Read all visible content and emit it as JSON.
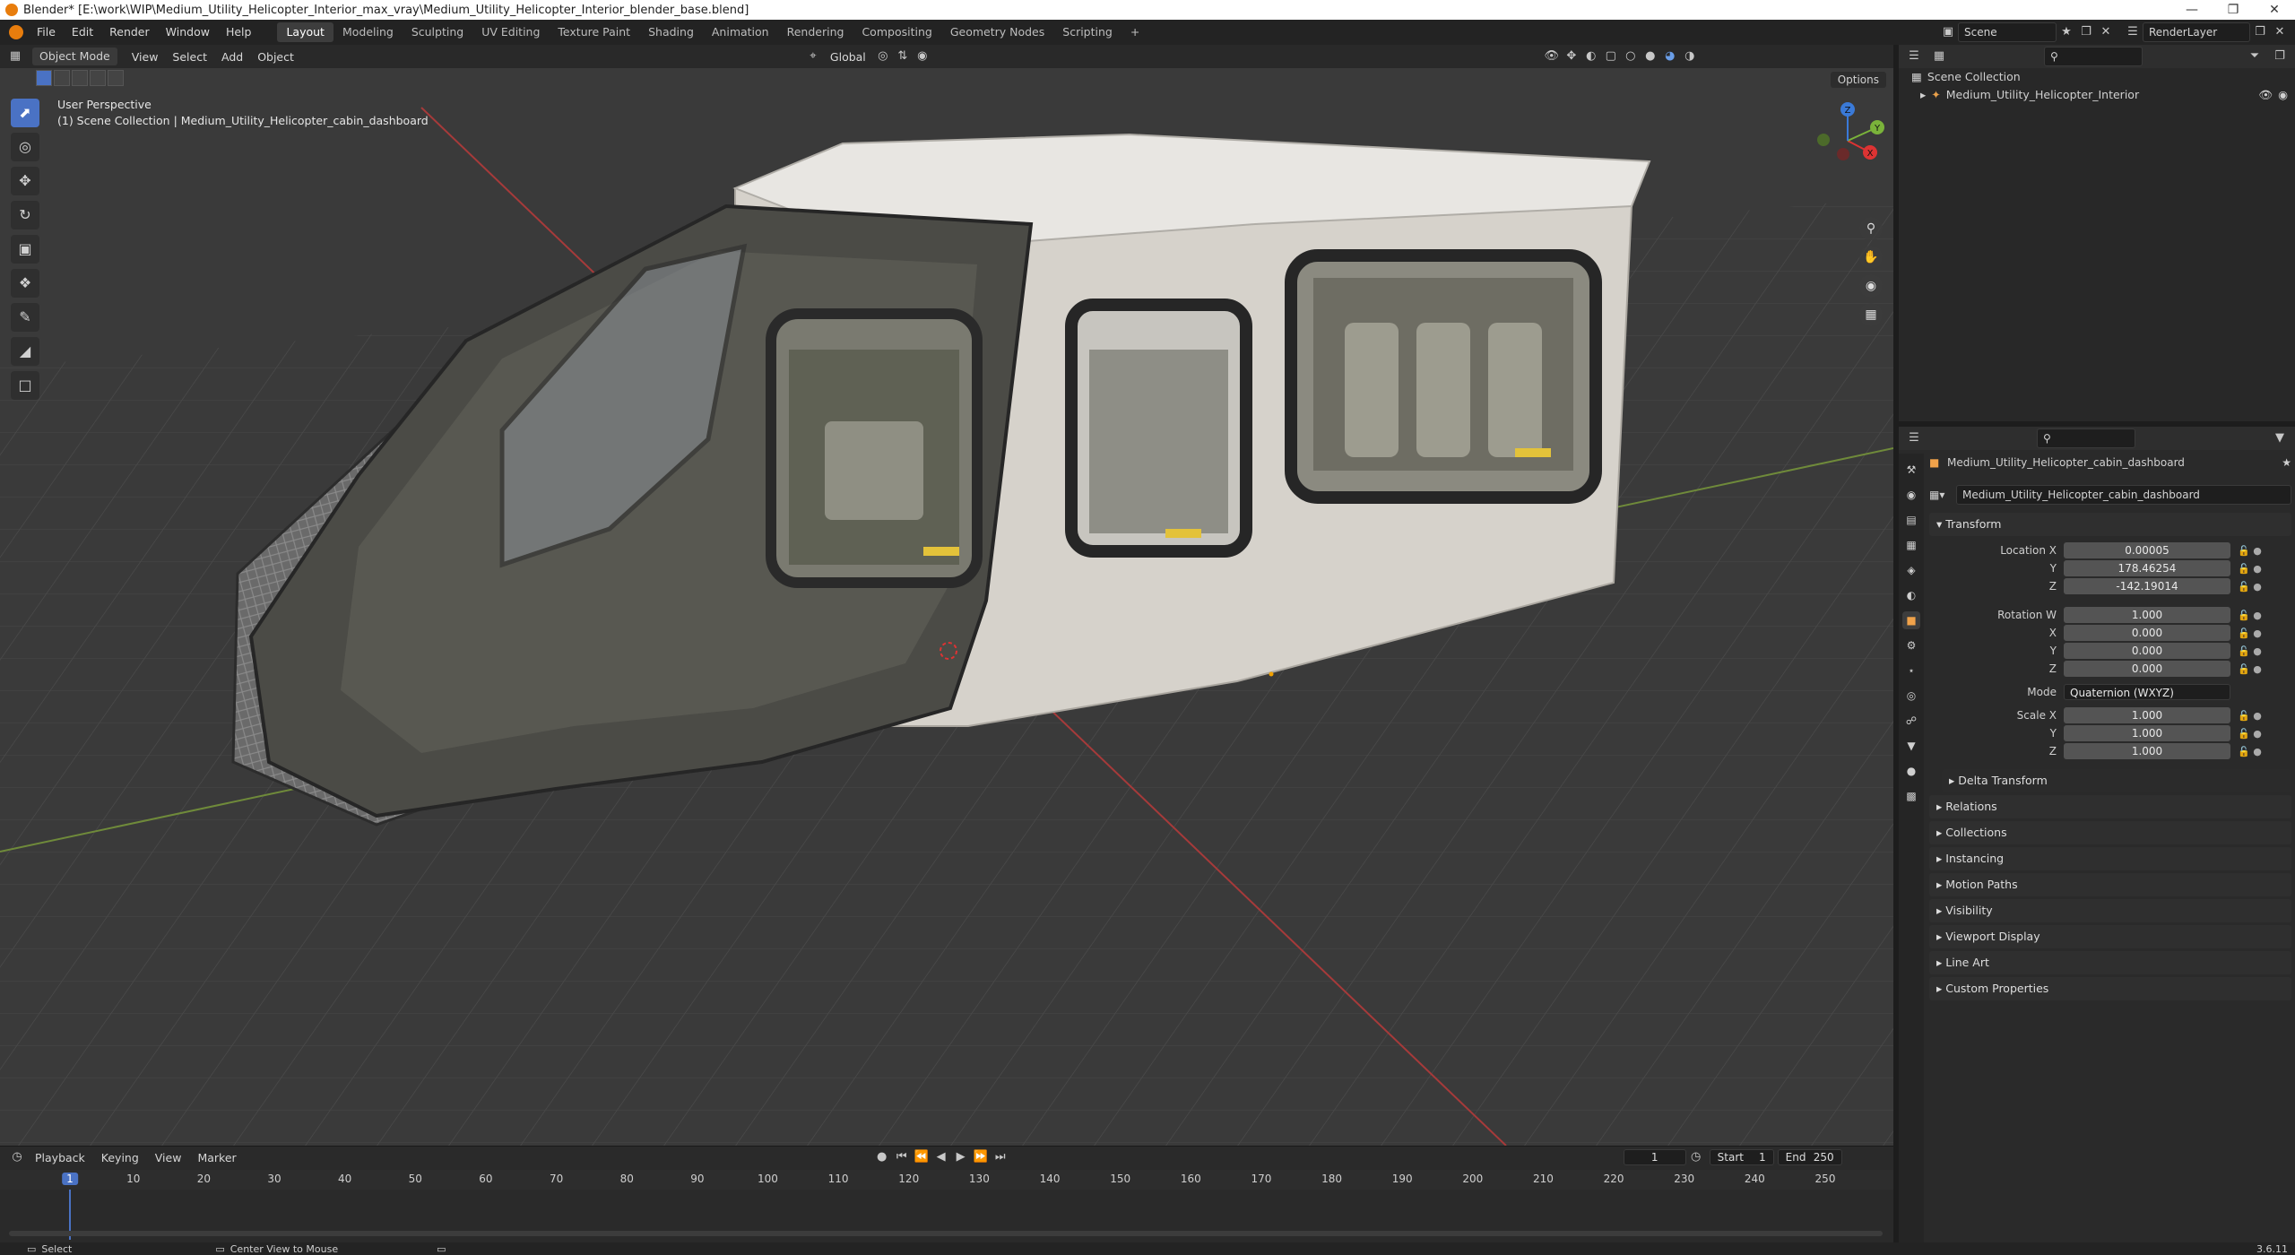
{
  "window": {
    "title": "Blender* [E:\\work\\WIP\\Medium_Utility_Helicopter_Interior_max_vray\\Medium_Utility_Helicopter_Interior_blender_base.blend]"
  },
  "menu": [
    "File",
    "Edit",
    "Render",
    "Window",
    "Help"
  ],
  "workspaces": [
    "Layout",
    "Modeling",
    "Sculpting",
    "UV Editing",
    "Texture Paint",
    "Shading",
    "Animation",
    "Rendering",
    "Compositing",
    "Geometry Nodes",
    "Scripting"
  ],
  "scene": {
    "name": "Scene",
    "view_layer": "RenderLayer"
  },
  "viewport": {
    "mode": "Object Mode",
    "menus": [
      "View",
      "Select",
      "Add",
      "Object"
    ],
    "orientation": "Global",
    "options_label": "Options",
    "overlay_line1": "User Perspective",
    "overlay_line2": "(1) Scene Collection | Medium_Utility_Helicopter_cabin_dashboard",
    "gizmo": {
      "x": "X",
      "y": "Y",
      "z": "Z"
    }
  },
  "outliner": {
    "root": "Scene Collection",
    "items": [
      "Medium_Utility_Helicopter_Interior"
    ]
  },
  "properties": {
    "object_name": "Medium_Utility_Helicopter_cabin_dashboard",
    "data_name": "Medium_Utility_Helicopter_cabin_dashboard",
    "transform_header": "Transform",
    "location": {
      "label": "Location X",
      "x": "0.00005",
      "y": "178.46254",
      "z": "-142.19014"
    },
    "rotation": {
      "label": "Rotation W",
      "w": "1.000",
      "x": "0.000",
      "y": "0.000",
      "z": "0.000"
    },
    "mode": {
      "label": "Mode",
      "value": "Quaternion (WXYZ)"
    },
    "scale": {
      "label": "Scale X",
      "x": "1.000",
      "y": "1.000",
      "z": "1.000"
    },
    "axis_labels": {
      "x": "X",
      "y": "Y",
      "z": "Z"
    },
    "delta": "Delta Transform",
    "panels": [
      "Relations",
      "Collections",
      "Instancing",
      "Motion Paths",
      "Visibility",
      "Viewport Display",
      "Line Art",
      "Custom Properties"
    ]
  },
  "timeline": {
    "menus": [
      "Playback",
      "Keying",
      "View",
      "Marker"
    ],
    "current_frame": "1",
    "start_label": "Start",
    "start": "1",
    "end_label": "End",
    "end": "250",
    "ticks": [
      "10",
      "20",
      "30",
      "40",
      "50",
      "60",
      "70",
      "80",
      "90",
      "100",
      "110",
      "120",
      "130",
      "140",
      "150",
      "160",
      "170",
      "180",
      "190",
      "200",
      "210",
      "220",
      "230",
      "240",
      "250"
    ]
  },
  "status": {
    "left": "Select",
    "middle": "Center View to Mouse",
    "version": "3.6.11"
  }
}
